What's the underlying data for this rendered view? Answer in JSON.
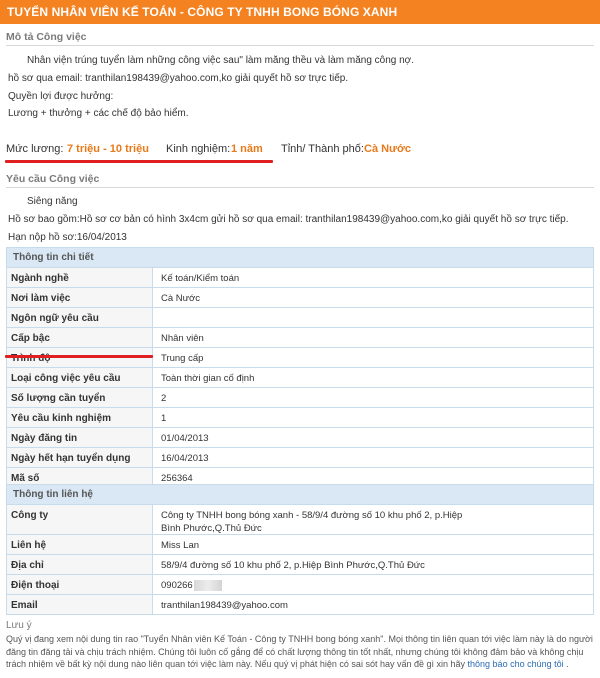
{
  "header": {
    "title": "TUYỂN NHÂN VIÊN KẾ TOÁN - CÔNG TY TNHH BONG BÓNG XANH"
  },
  "description": {
    "heading": "Mô tả Công việc",
    "lines": [
      "Nhân viện trúng tuyển làm những công việc sau\" làm măng thều và làm măng công nợ.",
      "hồ sơ qua email: tranthilan198439@yahoo.com,ko giải quyết hồ sơ trực tiếp.",
      "Quyền lợi được hưởng:",
      "Lương + thưởng + các chế độ bảo hiểm."
    ]
  },
  "summary": {
    "salary_label": "Mức lương:",
    "salary_value": "7 triệu - 10 triệu",
    "experience_label": "Kinh nghiệm:",
    "experience_value": "1 năm",
    "city_label": "Tỉnh/ Thành phố:",
    "city_value": "Cà Nước"
  },
  "requirements": {
    "heading": "Yêu cầu Công việc",
    "lines": [
      "Siêng năng",
      "Hồ sơ bao gồm:Hồ sơ cơ bản có hình 3x4cm gửi hồ sơ qua email: tranthilan198439@yahoo.com,ko giải quyết hồ sơ trực tiếp.",
      "Hạn nộp hồ sơ:16/04/2013"
    ]
  },
  "details": {
    "heading": "Thông tin chi tiết",
    "rows": [
      {
        "label": "Ngành nghề",
        "value": "Kế toán/Kiểm toán"
      },
      {
        "label": "Nơi làm việc",
        "value": "Cà Nước"
      },
      {
        "label": "Ngôn ngữ yêu cầu",
        "value": ""
      },
      {
        "label": "Cấp bậc",
        "value": "Nhân viên"
      },
      {
        "label": "Trình độ",
        "value": "Trung cấp"
      },
      {
        "label": "Loại công việc yêu cầu",
        "value": "Toàn thời gian cố định"
      },
      {
        "label": "Số lượng cần tuyển",
        "value": "2"
      },
      {
        "label": "Yêu cầu kinh nghiệm",
        "value": "1"
      },
      {
        "label": "Ngày đăng tin",
        "value": "01/04/2013"
      },
      {
        "label": "Ngày hết hạn tuyển dụng",
        "value": "16/04/2013"
      },
      {
        "label": "Mã số",
        "value": "256364"
      }
    ]
  },
  "contact": {
    "heading": "Thông tin liên hệ",
    "company_label": "Công ty",
    "company_line1": "Công ty TNHH bong bóng xanh - 58/9/4 đường số 10 khu phố 2, p.Hiệp",
    "company_line2": "Bình Phước,Q.Thủ Đức",
    "person_label": "Liên hệ",
    "person_value": "Miss Lan",
    "address_label": "Địa chỉ",
    "address_value": "58/9/4 đường số 10 khu phố 2, p.Hiệp Bình Phước,Q.Thủ Đức",
    "phone_label": "Điện thoại",
    "phone_value": "090266",
    "email_label": "Email",
    "email_value": "tranthilan198439@yahoo.com"
  },
  "note": {
    "heading": "Lưu ý",
    "text": "Quý vị đang xem nội dung tin rao \"Tuyển Nhân viên Kế Toán - Công ty TNHH bong bóng xanh\". Mọi thông tin liên quan tới việc làm này là do người đăng tin đăng tải và chịu trách nhiệm. Chúng tôi luôn cố gắng để có chất lượng thông tin tốt nhất, nhưng chúng tôi không đảm bảo và không chịu trách nhiệm về bất kỳ nội dung nào liên quan tới việc làm này. Nếu quý vị phát hiện có sai sót hay vấn đề gì xin hãy",
    "link": "thông báo cho chúng tôi"
  }
}
